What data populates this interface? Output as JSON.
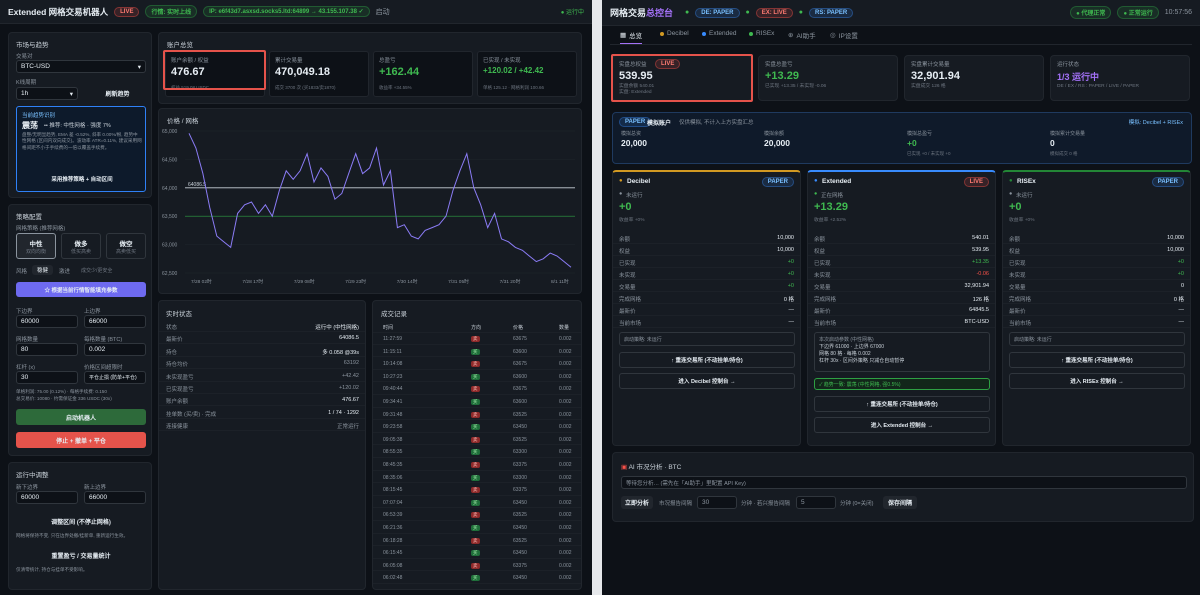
{
  "left": {
    "topbar": {
      "title": "Extended 网格交易机器人",
      "live": "LIVE",
      "connected": "行情: 实时上线",
      "ip": "IP: e6f43d7.asxsd.socks5.ltd:64899 → 43.155.107.38 ✓",
      "mode": "启动",
      "status": "运行中"
    },
    "market": {
      "title": "市场与趋势",
      "pair_label": "交易对",
      "pair": "BTC-USD",
      "kline_label": "K线周期",
      "kline": "1h",
      "refresh": "刷新趋势",
      "suggest_title": "当前趋势识别",
      "suggest_head": "震荡",
      "suggest_sub": "•• 推荐: 中性网格 · 强度 7%",
      "suggest_body": "盘整/无明显趋势, EMA 差 -0.52%, 斜率 0.00%/根, 趋势中性网格 (区间内双向成交)。波动率 ATR=0.11%, 建议采用网格间距不小于手续费的一倍以覆盖手续费。",
      "apply": "采用推荐策略 + 自动区间"
    },
    "config": {
      "title": "策略配置",
      "direction_label": "网格策略 (推荐网格)",
      "dirs": [
        {
          "name": "中性",
          "sub": "双向均衡"
        },
        {
          "name": "做多",
          "sub": "低买高卖"
        },
        {
          "name": "做空",
          "sub": "高卖低买"
        }
      ],
      "risk_label": "风格",
      "risk": [
        "稳健",
        "激进",
        "成交少/更安全"
      ],
      "auto_btn": "☆ 根据当前行情智能填充参数",
      "lower_label": "下边界",
      "lower": "60000",
      "upper_label": "上边界",
      "upper": "66000",
      "grids_label": "网格数量",
      "grids": "80",
      "qty_label": "每格数量 (BTC)",
      "qty": "0.002",
      "lev_label": "杠杆 (x)",
      "lev": "30",
      "tp_label": "价格区间超限时",
      "tp": "平仓止损 (防单+平仓)",
      "est": "单格利润: 75.00 (0.12%) · 每格手续费: 0.150\n总交易价: 10080 · 约需保证金 336 USDC (30x)",
      "start": "启动机器人",
      "stop": "停止 + 撤单 + 平仓"
    },
    "adjust": {
      "title": "运行中调整",
      "lower_label": "新下边界",
      "lower": "60000",
      "upper_label": "新上边界",
      "upper": "66000",
      "apply": "调整区间 (不停止网格)",
      "note1": "网格将保持不变, 只在边界处撤/挂新单, 重新运行生效。",
      "reset": "重置盈亏 / 交易量统计",
      "note2": "仅清零统计, 持仓与挂单不受影响。"
    },
    "account": {
      "title": "账户总览",
      "cards": [
        {
          "label": "账户余额 / 权益",
          "value": "476.67",
          "sub": "权益 519.08 USDC",
          "color": "white"
        },
        {
          "label": "累计交易量",
          "value": "470,049.18",
          "sub": "成交 3700 次 (买1833/卖1870)",
          "color": "white"
        },
        {
          "label": "总盈亏",
          "value": "+162.44",
          "sub": "收益率 +34.55%",
          "color": "green"
        },
        {
          "label": "已实现 / 未实现",
          "value": "+120.02 / +42.42",
          "sub": "单格 125.12 · 网格利润 100.66",
          "color": "green"
        }
      ]
    },
    "chart": {
      "title": "价格 / 网格",
      "ref_price": "64086.5",
      "y_ticks": [
        "65,000",
        "64,500",
        "64,000",
        "63,500",
        "63,000",
        "62,500"
      ],
      "x_ticks": [
        "7/28 02时",
        "7/28 17时",
        "7/29 08时",
        "7/29 23时",
        "7/30 14时",
        "7/31 05时",
        "7/31 20时",
        "8/1 11时"
      ]
    },
    "chart_data": {
      "type": "line",
      "ylim": [
        62500,
        65000
      ],
      "ref_lines": [
        64000,
        63500
      ],
      "series": [
        {
          "values": [
            64960,
            64700,
            64250,
            63650,
            63150,
            63050,
            62950,
            63550,
            63700,
            63750,
            63550,
            63700,
            63500,
            63950,
            64300,
            64150,
            64300,
            64600,
            64100,
            64350,
            64200,
            63800,
            63900,
            64250,
            64600,
            64250,
            64350,
            64700,
            64050,
            64300,
            63300,
            63350,
            63150,
            63100,
            63250,
            63300,
            63350,
            63500,
            63950,
            64300,
            64600,
            64000,
            63700,
            63300,
            63550,
            63100,
            63050,
            62950,
            62900,
            62800,
            62700,
            62750,
            62850,
            62800,
            62700,
            62600
          ]
        }
      ]
    },
    "realtime": {
      "title": "实时状态",
      "rows": [
        {
          "k": "状态",
          "v": "运行中 (中性网格)",
          "c": "white"
        },
        {
          "k": "最新价",
          "v": "64086.5",
          "c": "white"
        },
        {
          "k": "持仓",
          "v": "多 0.058 @39s",
          "c": "white"
        },
        {
          "k": "持仓均价",
          "v": "63192",
          "c": "grey"
        },
        {
          "k": "未实现盈亏",
          "v": "+42.42",
          "c": "grey"
        },
        {
          "k": "已实现盈亏",
          "v": "+120.02",
          "c": "grey"
        },
        {
          "k": "账户余额",
          "v": "476.67",
          "c": "white"
        },
        {
          "k": "挂单数 (买/卖) · 完成",
          "v": "1 / 74 · 1292",
          "c": "white"
        },
        {
          "k": "连接健康",
          "v": "正常运行",
          "c": "grey"
        }
      ]
    },
    "trades": {
      "title": "成交记录",
      "cols": [
        "时间",
        "方向",
        "价格",
        "数量"
      ],
      "rows": [
        [
          "11:27:59",
          "卖",
          "63675",
          "0.002"
        ],
        [
          "11:15:11",
          "买",
          "63600",
          "0.002"
        ],
        [
          "10:14:08",
          "卖",
          "63675",
          "0.002"
        ],
        [
          "10:27:23",
          "买",
          "63600",
          "0.002"
        ],
        [
          "09:40:44",
          "卖",
          "63675",
          "0.002"
        ],
        [
          "09:34:41",
          "买",
          "63600",
          "0.002"
        ],
        [
          "09:31:48",
          "卖",
          "63525",
          "0.002"
        ],
        [
          "09:23:58",
          "买",
          "63450",
          "0.002"
        ],
        [
          "09:05:38",
          "卖",
          "63525",
          "0.002"
        ],
        [
          "08:55:35",
          "买",
          "63300",
          "0.002"
        ],
        [
          "08:45:35",
          "卖",
          "63375",
          "0.002"
        ],
        [
          "08:35:06",
          "买",
          "63300",
          "0.002"
        ],
        [
          "08:15:45",
          "卖",
          "63375",
          "0.002"
        ],
        [
          "07:07:04",
          "买",
          "63450",
          "0.002"
        ],
        [
          "06:53:39",
          "卖",
          "63525",
          "0.002"
        ],
        [
          "06:21:36",
          "买",
          "63450",
          "0.002"
        ],
        [
          "06:18:28",
          "卖",
          "63525",
          "0.002"
        ],
        [
          "06:15:45",
          "买",
          "63450",
          "0.002"
        ],
        [
          "06:05:08",
          "卖",
          "63375",
          "0.002"
        ],
        [
          "06:02:48",
          "买",
          "63450",
          "0.002"
        ]
      ]
    }
  },
  "right": {
    "topbar": {
      "title_a": "网格交易",
      "title_b": "总控台",
      "de": "DE: PAPER",
      "ex": "EX: LIVE",
      "rs": "RS: PAPER",
      "proxy": "代理正常",
      "status": "正常运行",
      "time": "10:57:56"
    },
    "tabs": [
      "总览",
      "Decibel",
      "Extended",
      "RISEx",
      "AI助手",
      "IP设置"
    ],
    "summary": [
      {
        "label": "实盘总权益",
        "badge": "LIVE",
        "value": "539.95",
        "sub": "实盘余额 540.01\n实盘: Extended",
        "color": "white"
      },
      {
        "label": "实盘总盈亏",
        "value": "+13.29",
        "sub": "已实现 +13.35 / 未实现 -0.06",
        "color": "green"
      },
      {
        "label": "实盘累计交易量",
        "value": "32,901.94",
        "sub": "实盘成交 126 格",
        "color": "white"
      },
      {
        "label": "运行状态",
        "value": "1/3 运行中",
        "sub": "DE / EX / RS : PAPER / LIVE / PAPER",
        "color": "purple"
      }
    ],
    "paper": {
      "badge": "PAPER",
      "title": "模拟账户",
      "note": "仅供模拟, 不计入上方实盘汇总",
      "right": "模拟: Decibel + RISEx",
      "cells": [
        {
          "label": "模拟总资",
          "value": "20,000",
          "sub": "",
          "color": "white"
        },
        {
          "label": "模拟余额",
          "value": "20,000",
          "sub": "",
          "color": "white"
        },
        {
          "label": "模拟总盈亏",
          "value": "+0",
          "sub": "已实现 +0 / 未实现 +0",
          "color": "green"
        },
        {
          "label": "模拟累计交易量",
          "value": "0",
          "sub": "模拟成交 0 格",
          "color": "white"
        }
      ]
    },
    "exchanges": [
      {
        "name": "Decibel",
        "badge": "PAPER",
        "state": "未运行",
        "pnl": "+0",
        "pnl_sub": "收益率 +0%",
        "rows": [
          [
            "余额",
            "10,000"
          ],
          [
            "权益",
            "10,000"
          ],
          [
            "已实现",
            "+0"
          ],
          [
            "未实现",
            "+0"
          ],
          [
            "交易量",
            "+0"
          ],
          [
            "完成网格",
            "0 格"
          ],
          [
            "最新价",
            "—"
          ],
          [
            "当前市场",
            "—"
          ]
        ],
        "info": "启动策略: 未运行",
        "info2": "",
        "confirm": "",
        "btn1": "↑ 重连交易所 (不动挂单/持仓)",
        "btn2": "进入 Decibel 控制台 →",
        "accent": "#d29922"
      },
      {
        "name": "Extended",
        "badge": "LIVE",
        "state": "正在网格",
        "pnl": "+13.29",
        "pnl_sub": "收益率 +2.52%",
        "rows": [
          [
            "余额",
            "540.01"
          ],
          [
            "权益",
            "539.95"
          ],
          [
            "已实现",
            "+13.35"
          ],
          [
            "未实现",
            "-0.06"
          ],
          [
            "交易量",
            "32,901.94"
          ],
          [
            "完成网格",
            "126 格"
          ],
          [
            "最新价",
            "64845.5"
          ],
          [
            "当前市场",
            "BTC-USD"
          ]
        ],
        "info": "本次启动参数 (中性网格)",
        "info2": "下边界 61000 · 上边界 67000\n网格 80 格 · 每格 0.002\n杠杆 30x · 区间外策略 只减仓自动暂停",
        "confirm": "✓ 趋势一致: 震荡 (中性网格, 强0.5%)",
        "btn1": "↑ 重连交易所 (不动挂单/持仓)",
        "btn2": "进入 Extended 控制台 →",
        "accent": "#388bfd"
      },
      {
        "name": "RISEx",
        "badge": "PAPER",
        "state": "未运行",
        "pnl": "+0",
        "pnl_sub": "收益率 +0%",
        "rows": [
          [
            "余额",
            "10,000"
          ],
          [
            "权益",
            "10,000"
          ],
          [
            "已实现",
            "+0"
          ],
          [
            "未实现",
            "+0"
          ],
          [
            "交易量",
            "0"
          ],
          [
            "完成网格",
            "0 格"
          ],
          [
            "最新价",
            "—"
          ],
          [
            "当前市场",
            "—"
          ]
        ],
        "info": "启动策略: 未运行",
        "info2": "",
        "confirm": "",
        "btn1": "↑ 重连交易所 (不动挂单/持仓)",
        "btn2": "进入 RISEx 控制台 →",
        "accent": "#238636"
      }
    ],
    "ai": {
      "title": "AI 市况分析 · BTC",
      "input": "等待您分析… (需先在「AI助手」里配置 API Key)",
      "analyze": "立即分析",
      "interval_label": "市况报告间隔",
      "interval": "30",
      "unit": "分钟 · 若兴报告间隔",
      "interval2": "5",
      "unit2": "分钟 (0=关闭)",
      "save": "保存间隔"
    }
  }
}
